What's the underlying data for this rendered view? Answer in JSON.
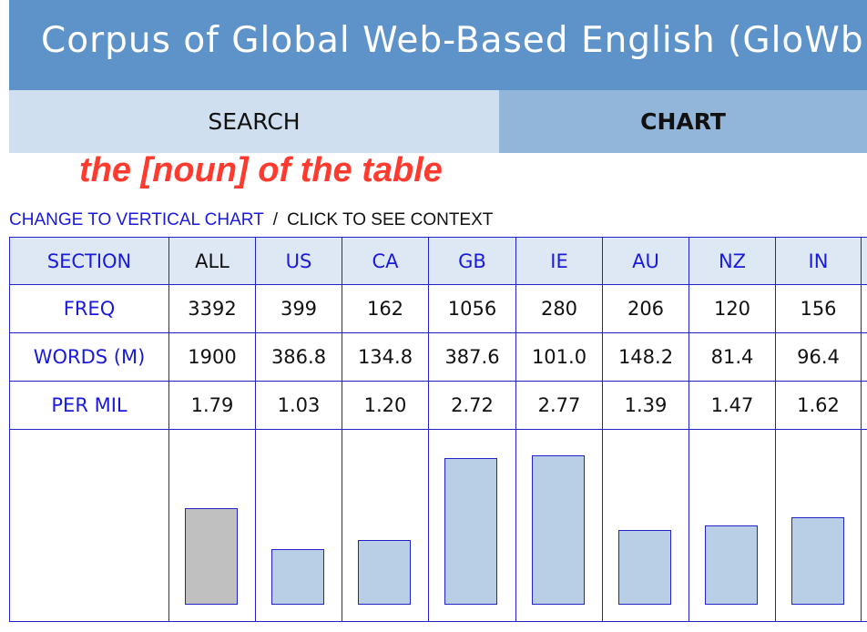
{
  "header": {
    "title": "Corpus of Global Web-Based English (GloWbE)"
  },
  "tabs": {
    "search": "SEARCH",
    "chart": "CHART"
  },
  "query": "the [noun] of the table",
  "links": {
    "vertical": "CHANGE TO VERTICAL CHART",
    "separator": "/",
    "context": "CLICK TO SEE CONTEXT"
  },
  "table": {
    "row_labels": {
      "section": "SECTION",
      "freq": "FREQ",
      "words": "WORDS (M)",
      "permil": "PER MIL"
    },
    "columns": [
      {
        "section": "ALL",
        "freq": "3392",
        "words": "1900",
        "permil": "1.79",
        "per_mil_value": 1.79
      },
      {
        "section": "US",
        "freq": "399",
        "words": "386.8",
        "permil": "1.03",
        "per_mil_value": 1.03
      },
      {
        "section": "CA",
        "freq": "162",
        "words": "134.8",
        "permil": "1.20",
        "per_mil_value": 1.2
      },
      {
        "section": "GB",
        "freq": "1056",
        "words": "387.6",
        "permil": "2.72",
        "per_mil_value": 2.72
      },
      {
        "section": "IE",
        "freq": "280",
        "words": "101.0",
        "permil": "2.77",
        "per_mil_value": 2.77
      },
      {
        "section": "AU",
        "freq": "206",
        "words": "148.2",
        "permil": "1.39",
        "per_mil_value": 1.39
      },
      {
        "section": "NZ",
        "freq": "120",
        "words": "81.4",
        "permil": "1.47",
        "per_mil_value": 1.47
      },
      {
        "section": "IN",
        "freq": "156",
        "words": "96.4",
        "permil": "1.62",
        "per_mil_value": 1.62
      }
    ]
  },
  "colors": {
    "header_bg": "#5e93c9",
    "link": "#1a1adb",
    "query": "#ff3b30",
    "bar": "#b8cfe6",
    "bar_all": "#c0c0c0"
  }
}
